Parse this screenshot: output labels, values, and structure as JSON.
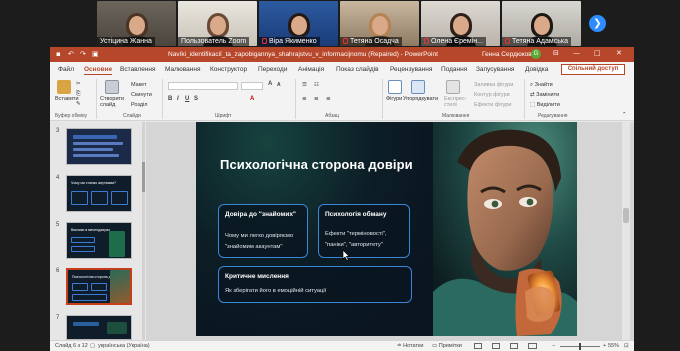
{
  "zoom": {
    "participants": [
      {
        "name": "Устіцина Жанна",
        "muted": false
      },
      {
        "name": "Пользователь Zoom",
        "muted": false
      },
      {
        "name": "Віра Якименко",
        "muted": true
      },
      {
        "name": "Тетяна Осадча",
        "muted": true
      },
      {
        "name": "Олена Єремін...",
        "muted": true
      },
      {
        "name": "Тетяна Адамська",
        "muted": true
      }
    ],
    "next_label": "❯"
  },
  "powerpoint": {
    "title": "Navíki_identifikaciï_ta_zapobigannya_shahrajstvu_v_informacijnomu (Repaired) - PowerPoint",
    "user_name": "Генна Сердюкова",
    "user_initial": "G",
    "tabs": [
      "Файл",
      "Основне",
      "Вставлення",
      "Малювання",
      "Конструктор",
      "Переходи",
      "Анімація",
      "Показ слайдів",
      "Рецензування",
      "Подання",
      "Запусування",
      "Довідка"
    ],
    "active_tab": "Основне",
    "share_label": "Спільний доступ",
    "ribbon": {
      "paste": "Вставити",
      "new_slide": "Створити слайд",
      "layout": "Макет",
      "reset": "Скинути",
      "section": "Розділ",
      "shapes": "Фігури",
      "arrange": "Упорядкувати",
      "quick_styles": "Експрес-стилі",
      "fill": "Заливка фігури",
      "outline": "Контур фігури",
      "effects": "Ефекти фігури",
      "find": "Знайти",
      "replace": "Замінити",
      "select": "Виділити",
      "groups": {
        "clipboard": "Буфер обміну",
        "slides": "Слайди",
        "font": "Шрифт",
        "paragraph": "Абзац",
        "drawing": "Малювання",
        "editing": "Редагування"
      }
    },
    "thumbnails": [
      {
        "num": "3",
        "title": ""
      },
      {
        "num": "4",
        "title": "Чому ми стаємо жертвами?"
      },
      {
        "num": "5",
        "title": "Виклики в месенджерах"
      },
      {
        "num": "6",
        "title": "Психологічна сторона довіри",
        "selected": true
      },
      {
        "num": "7",
        "title": ""
      }
    ],
    "slide": {
      "title": "Психологічна сторона довіри",
      "card1": {
        "title": "Довіра до \"знайомих\"",
        "text1": "Чому ми легко довіряємо",
        "text2": "\"знайомим акаунтам\""
      },
      "card2": {
        "title": "Психологія обману",
        "text1": "Ефекти \"терміновості\",",
        "text2": "\"паніки\", \"авторитету\""
      },
      "card3": {
        "title": "Критичне мислення",
        "text1": "Як зберігати його в емоційній ситуації"
      }
    },
    "status": {
      "slide_counter": "Слайд 6 з 12",
      "language": "українська (Україна)",
      "notes": "Нотатки",
      "comments": "Примітки",
      "zoom_level": "55%"
    }
  }
}
